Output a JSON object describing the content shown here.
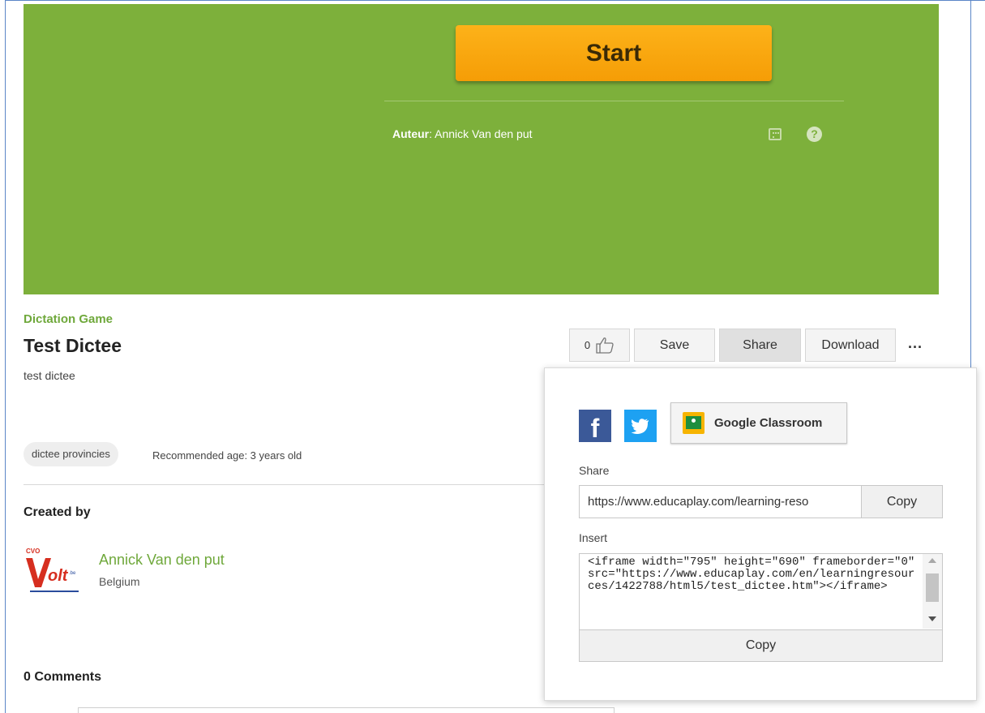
{
  "game": {
    "start_label": "Start",
    "author_label": "Auteur",
    "author_name": ": Annick Van den put"
  },
  "activity": {
    "category": "Dictation Game",
    "title": "Test Dictee",
    "description": "test dictee",
    "tag": "dictee provincies",
    "age": "Recommended age: 3 years old"
  },
  "actions": {
    "likes": "0",
    "save_label": "Save",
    "share_label": "Share",
    "download_label": "Download",
    "more_label": "..."
  },
  "creator": {
    "section_label": "Created by",
    "name": "Annick Van den put",
    "country": "Belgium"
  },
  "comments": {
    "label": "0 Comments"
  },
  "share_popup": {
    "google_classroom_label": "Google Classroom",
    "share_label": "Share",
    "share_url": "https://www.educaplay.com/learning-reso",
    "copy_label": "Copy",
    "insert_label": "Insert",
    "embed_code": "<iframe width=\"795\" height=\"690\" frameborder=\"0\" src=\"https://www.educaplay.com/en/learningresources/1422788/html5/test_dictee.htm\"></iframe>",
    "copy_embed_label": "Copy"
  },
  "colors": {
    "game_bg": "#7db03b",
    "start_button": "#f7a80d",
    "brand_green": "#6fa83b",
    "facebook": "#3b5998",
    "twitter": "#1da1f2"
  }
}
